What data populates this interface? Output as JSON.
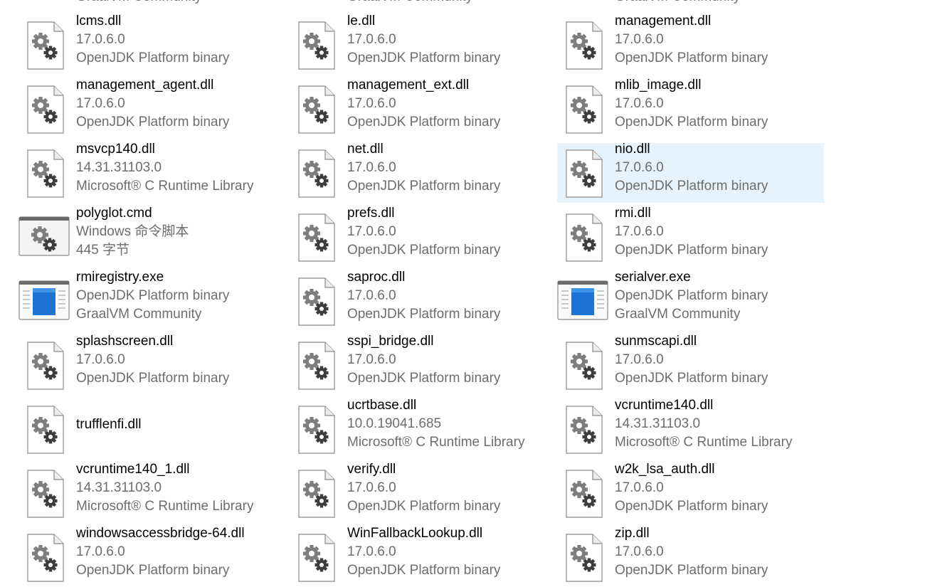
{
  "colors": {
    "selection": "#e5f3fe",
    "name_text": "#000000",
    "meta_text": "#6d6d6d"
  },
  "partial_top_row": [
    "GraalVM Community",
    "GraalVM Community",
    "GraalVM Community"
  ],
  "files": [
    {
      "name": "lcms.dll",
      "line2": "17.0.6.0",
      "line3": "OpenJDK Platform binary",
      "icon": "dll-gear-icon"
    },
    {
      "name": "le.dll",
      "line2": "17.0.6.0",
      "line3": "OpenJDK Platform binary",
      "icon": "dll-gear-icon"
    },
    {
      "name": "management.dll",
      "line2": "17.0.6.0",
      "line3": "OpenJDK Platform binary",
      "icon": "dll-gear-icon"
    },
    {
      "name": "management_agent.dll",
      "line2": "17.0.6.0",
      "line3": "OpenJDK Platform binary",
      "icon": "dll-gear-icon"
    },
    {
      "name": "management_ext.dll",
      "line2": "17.0.6.0",
      "line3": "OpenJDK Platform binary",
      "icon": "dll-gear-icon"
    },
    {
      "name": "mlib_image.dll",
      "line2": "17.0.6.0",
      "line3": "OpenJDK Platform binary",
      "icon": "dll-gear-icon"
    },
    {
      "name": "msvcp140.dll",
      "line2": "14.31.31103.0",
      "line3": "Microsoft® C Runtime Library",
      "icon": "dll-gear-icon"
    },
    {
      "name": "net.dll",
      "line2": "17.0.6.0",
      "line3": "OpenJDK Platform binary",
      "icon": "dll-gear-icon"
    },
    {
      "name": "nio.dll",
      "line2": "17.0.6.0",
      "line3": "OpenJDK Platform binary",
      "icon": "dll-gear-icon",
      "selected": true
    },
    {
      "name": "polyglot.cmd",
      "line2": "Windows 命令脚本",
      "line3": "445 字节",
      "icon": "cmd-script-icon"
    },
    {
      "name": "prefs.dll",
      "line2": "17.0.6.0",
      "line3": "OpenJDK Platform binary",
      "icon": "dll-gear-icon"
    },
    {
      "name": "rmi.dll",
      "line2": "17.0.6.0",
      "line3": "OpenJDK Platform binary",
      "icon": "dll-gear-icon"
    },
    {
      "name": "rmiregistry.exe",
      "line2": "OpenJDK Platform binary",
      "line3": "GraalVM Community",
      "icon": "exe-window-icon"
    },
    {
      "name": "saproc.dll",
      "line2": "17.0.6.0",
      "line3": "OpenJDK Platform binary",
      "icon": "dll-gear-icon"
    },
    {
      "name": "serialver.exe",
      "line2": "OpenJDK Platform binary",
      "line3": "GraalVM Community",
      "icon": "exe-window-icon"
    },
    {
      "name": "splashscreen.dll",
      "line2": "17.0.6.0",
      "line3": "OpenJDK Platform binary",
      "icon": "dll-gear-icon"
    },
    {
      "name": "sspi_bridge.dll",
      "line2": "17.0.6.0",
      "line3": "OpenJDK Platform binary",
      "icon": "dll-gear-icon"
    },
    {
      "name": "sunmscapi.dll",
      "line2": "17.0.6.0",
      "line3": "OpenJDK Platform binary",
      "icon": "dll-gear-icon"
    },
    {
      "name": "trufflenfi.dll",
      "line2": "",
      "line3": "",
      "icon": "dll-gear-icon",
      "single_line": true
    },
    {
      "name": "ucrtbase.dll",
      "line2": "10.0.19041.685",
      "line3": "Microsoft® C Runtime Library",
      "icon": "dll-gear-icon"
    },
    {
      "name": "vcruntime140.dll",
      "line2": "14.31.31103.0",
      "line3": "Microsoft® C Runtime Library",
      "icon": "dll-gear-icon"
    },
    {
      "name": "vcruntime140_1.dll",
      "line2": "14.31.31103.0",
      "line3": "Microsoft® C Runtime Library",
      "icon": "dll-gear-icon"
    },
    {
      "name": "verify.dll",
      "line2": "17.0.6.0",
      "line3": "OpenJDK Platform binary",
      "icon": "dll-gear-icon"
    },
    {
      "name": "w2k_lsa_auth.dll",
      "line2": "17.0.6.0",
      "line3": "OpenJDK Platform binary",
      "icon": "dll-gear-icon"
    },
    {
      "name": "windowsaccessbridge-64.dll",
      "line2": "17.0.6.0",
      "line3": "OpenJDK Platform binary",
      "icon": "dll-gear-icon"
    },
    {
      "name": "WinFallbackLookup.dll",
      "line2": "17.0.6.0",
      "line3": "OpenJDK Platform binary",
      "icon": "dll-gear-icon"
    },
    {
      "name": "zip.dll",
      "line2": "17.0.6.0",
      "line3": "OpenJDK Platform binary",
      "icon": "dll-gear-icon"
    }
  ]
}
